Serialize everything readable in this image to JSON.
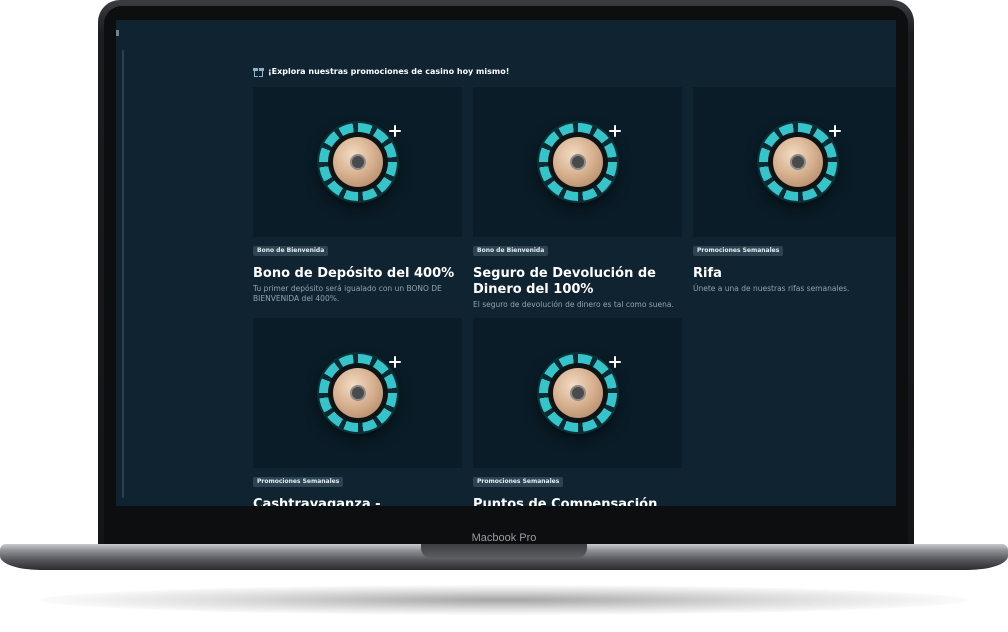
{
  "device": {
    "label": "Macbook Pro"
  },
  "page": {
    "heading": "¡Explora nuestras promociones de casino hoy mismo!"
  },
  "promotions": [
    {
      "badge": "Bono de Bienvenida",
      "title": "Bono de Depósito del 400%",
      "description": "Tu primer depósito será igualado con un BONO DE BIENVENIDA del 400%."
    },
    {
      "badge": "Bono de Bienvenida",
      "title": "Seguro de Devolución de Dinero del 100%",
      "description": "El seguro de devolución de dinero es tal como suena."
    },
    {
      "badge": "Promociones Semanales",
      "title": "Rifa",
      "description": "Únete a una de nuestras rifas semanales."
    },
    {
      "badge": "Promociones Semanales",
      "title": "Cashtravaganza - Reembolso al",
      "description": ""
    },
    {
      "badge": "Promociones Semanales",
      "title": "Puntos de Compensación",
      "description": ""
    }
  ]
}
